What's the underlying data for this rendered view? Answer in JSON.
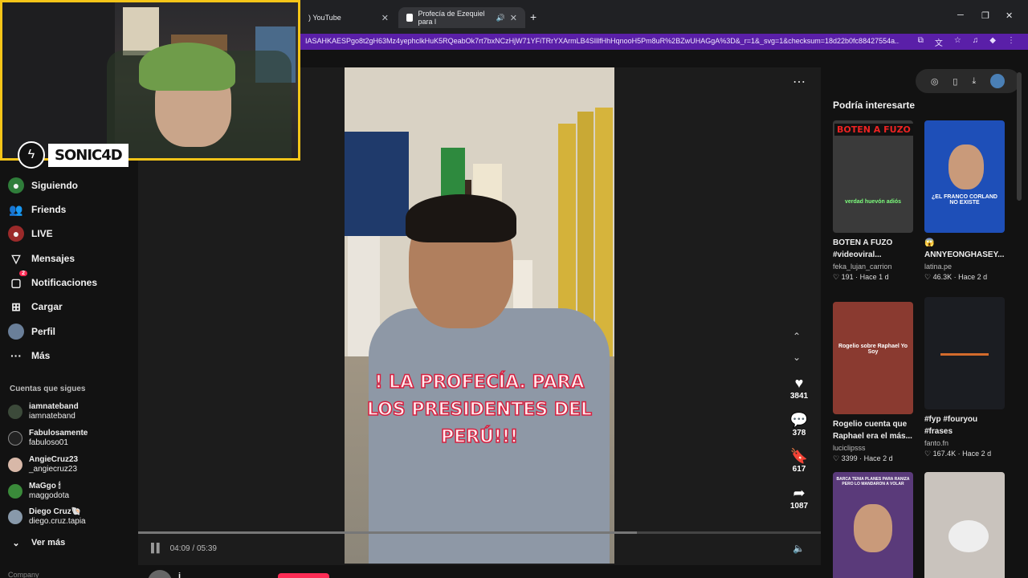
{
  "browser": {
    "tabs": [
      {
        "label": ") YouTube"
      },
      {
        "label": "Profecía de Ezequiel para l"
      }
    ],
    "url": "IASAHKAESPgo8t2gH63Mz4yephclkHuK5RQeabOk7rt7bxNCzHjW71YFiTRrYXArmLB4SIllfHhHqnooH5Pm8uR%2BZwUHAGgA%3D&_r=1&_svg=1&checksum=18d22b0fc88427554a..."
  },
  "webcam": {
    "streamer_name": "SONIC4D"
  },
  "sidebar": {
    "nav": [
      {
        "label": "Siguiendo",
        "icon": "following-icon"
      },
      {
        "label": "Friends",
        "icon": "friends-icon"
      },
      {
        "label": "LIVE",
        "icon": "live-icon"
      },
      {
        "label": "Mensajes",
        "icon": "messages-icon"
      },
      {
        "label": "Notificaciones",
        "icon": "notifications-icon",
        "badge": "2"
      },
      {
        "label": "Cargar",
        "icon": "upload-icon"
      },
      {
        "label": "Perfil",
        "icon": "profile-icon"
      },
      {
        "label": "Más",
        "icon": "more-icon"
      }
    ],
    "following_title": "Cuentas que sigues",
    "following": [
      {
        "name": "iamnateband",
        "handle": "iamnateband",
        "color": "#3c4a3a"
      },
      {
        "name": "Fabulosamente",
        "handle": "fabuloso01",
        "color": "#222"
      },
      {
        "name": "AngieCruz23",
        "handle": "_angiecruz23",
        "color": "#d8b8a8"
      },
      {
        "name": "MaGgo 🕯",
        "handle": "maggodota",
        "color": "#3a8a3a"
      },
      {
        "name": "Diego Cruz🐚",
        "handle": "diego.cruz.tapia",
        "color": "#8899aa"
      }
    ],
    "see_more": "Ver más",
    "footer": "Company"
  },
  "video": {
    "overlay_lines": [
      "!  LA PROFECÍA. PARA",
      "LOS PRESIDENTES DEL",
      "PERÚ!!!"
    ],
    "likes": "3841",
    "comments": "378",
    "saves": "617",
    "shares": "1087",
    "time": "04:09 / 05:39",
    "progress": 0.73,
    "author": "j"
  },
  "right_panel": {
    "title": "Podría interesarte",
    "cards": [
      {
        "caption": "BOTEN A FUZO #videoviral...",
        "user": "feka_lujan_carrion",
        "likes": "191",
        "age": "Hace 1 d",
        "tag": "BOTEN A FUZO",
        "thumb_caption": "verdad huevón adiós",
        "thumb_color": "#3a3a3a"
      },
      {
        "caption": "😱 ANNYEONGHASEY...",
        "user": "latina.pe",
        "likes": "46.3K",
        "age": "Hace 2 d",
        "tag": "",
        "thumb_caption": "¿EL FRANCO CORLAND NO EXISTE",
        "thumb_color": "#1e4fb8"
      },
      {
        "caption": "Rogelio cuenta que Raphael era el más...",
        "user": "luciclipsss",
        "likes": "3399",
        "age": "Hace 2 d",
        "tag": "",
        "thumb_caption": "Rogelio sobre Raphael Yo Soy",
        "thumb_color": "#8a3a30"
      },
      {
        "caption": "#fyp #fouryou #frases",
        "user": "fanto.fn",
        "likes": "167.4K",
        "age": "Hace 2 d",
        "tag": "",
        "thumb_caption": "",
        "thumb_color": "#1b1d22"
      },
      {
        "caption": "",
        "user": "",
        "likes": "",
        "age": "",
        "tag": "",
        "thumb_caption": "BARCA TENIA PLANES PARA RANIZA PERO LO MANDARON A VOLAR",
        "thumb_color": "#5a3a7a"
      },
      {
        "caption": "",
        "user": "",
        "likes": "",
        "age": "",
        "tag": "",
        "thumb_caption": "",
        "thumb_color": "#c9c3bd"
      }
    ]
  },
  "colors": {
    "accent": "#fe2c55",
    "address_bar": "#5a1fa8",
    "webcam_border": "#f5c518"
  }
}
